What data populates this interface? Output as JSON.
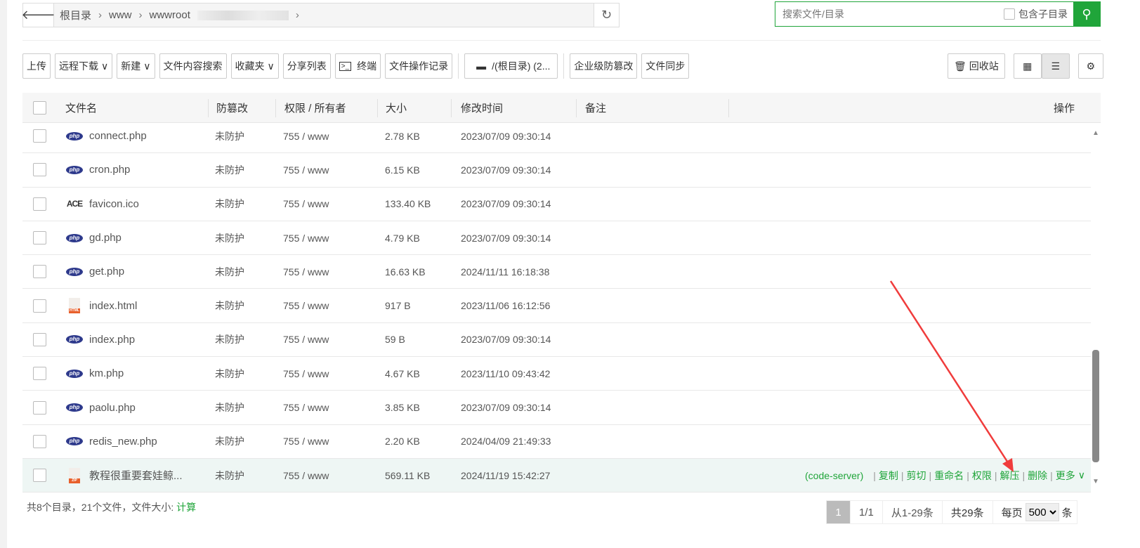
{
  "path": {
    "crumbs": [
      "根目录",
      "www",
      "wwwroot"
    ]
  },
  "search": {
    "placeholder": "搜索文件/目录",
    "subdir_label": "包含子目录"
  },
  "toolbar": [
    "上传",
    "远程下载",
    "新建",
    "文件内容搜索",
    "收藏夹",
    "分享列表",
    "终端",
    "文件操作记录",
    "/(根目录) (2...",
    "企业级防篡改",
    "文件同步"
  ],
  "toolbar_dropdown": [
    false,
    true,
    true,
    false,
    true,
    false,
    false,
    false,
    false,
    false,
    false
  ],
  "recycle_label": "回收站",
  "headers": {
    "name": "文件名",
    "tamper": "防篡改",
    "perm": "权限 / 所有者",
    "size": "大小",
    "mtime": "修改时间",
    "note": "备注",
    "ops": "操作"
  },
  "files": [
    {
      "name": "connect.php",
      "icon": "php",
      "tamper": "未防护",
      "perm": "755 / www",
      "size": "2.78 KB",
      "mtime": "2023/07/09 09:30:14"
    },
    {
      "name": "cron.php",
      "icon": "php",
      "tamper": "未防护",
      "perm": "755 / www",
      "size": "6.15 KB",
      "mtime": "2023/07/09 09:30:14"
    },
    {
      "name": "favicon.ico",
      "icon": "ace",
      "tamper": "未防护",
      "perm": "755 / www",
      "size": "133.40 KB",
      "mtime": "2023/07/09 09:30:14"
    },
    {
      "name": "gd.php",
      "icon": "php",
      "tamper": "未防护",
      "perm": "755 / www",
      "size": "4.79 KB",
      "mtime": "2023/07/09 09:30:14"
    },
    {
      "name": "get.php",
      "icon": "php",
      "tamper": "未防护",
      "perm": "755 / www",
      "size": "16.63 KB",
      "mtime": "2024/11/11 16:18:38"
    },
    {
      "name": "index.html",
      "icon": "html",
      "tamper": "未防护",
      "perm": "755 / www",
      "size": "917 B",
      "mtime": "2023/11/06 16:12:56"
    },
    {
      "name": "index.php",
      "icon": "php",
      "tamper": "未防护",
      "perm": "755 / www",
      "size": "59 B",
      "mtime": "2023/07/09 09:30:14"
    },
    {
      "name": "km.php",
      "icon": "php",
      "tamper": "未防护",
      "perm": "755 / www",
      "size": "4.67 KB",
      "mtime": "2023/11/10 09:43:42"
    },
    {
      "name": "paolu.php",
      "icon": "php",
      "tamper": "未防护",
      "perm": "755 / www",
      "size": "3.85 KB",
      "mtime": "2023/07/09 09:30:14"
    },
    {
      "name": "redis_new.php",
      "icon": "php",
      "tamper": "未防护",
      "perm": "755 / www",
      "size": "2.20 KB",
      "mtime": "2024/04/09 21:49:33"
    },
    {
      "name": "教程很重要套娃鲸...",
      "icon": "zip",
      "tamper": "未防护",
      "perm": "755 / www",
      "size": "569.11 KB",
      "mtime": "2024/11/19 15:42:27"
    }
  ],
  "row_ops": [
    "(code-server)",
    "复制",
    "剪切",
    "重命名",
    "权限",
    "解压",
    "删除",
    "更多"
  ],
  "footer": {
    "summary": "共8个目录，21个文件，文件大小: ",
    "calc": "计算"
  },
  "pager": {
    "current": "1",
    "pages": "1/1",
    "range": "从1-29条",
    "total": "共29条",
    "per_page_label": "每页",
    "per_page": "500",
    "unit": "条"
  },
  "colors": {
    "accent": "#20a53a",
    "arrow": "#f03c3c"
  }
}
